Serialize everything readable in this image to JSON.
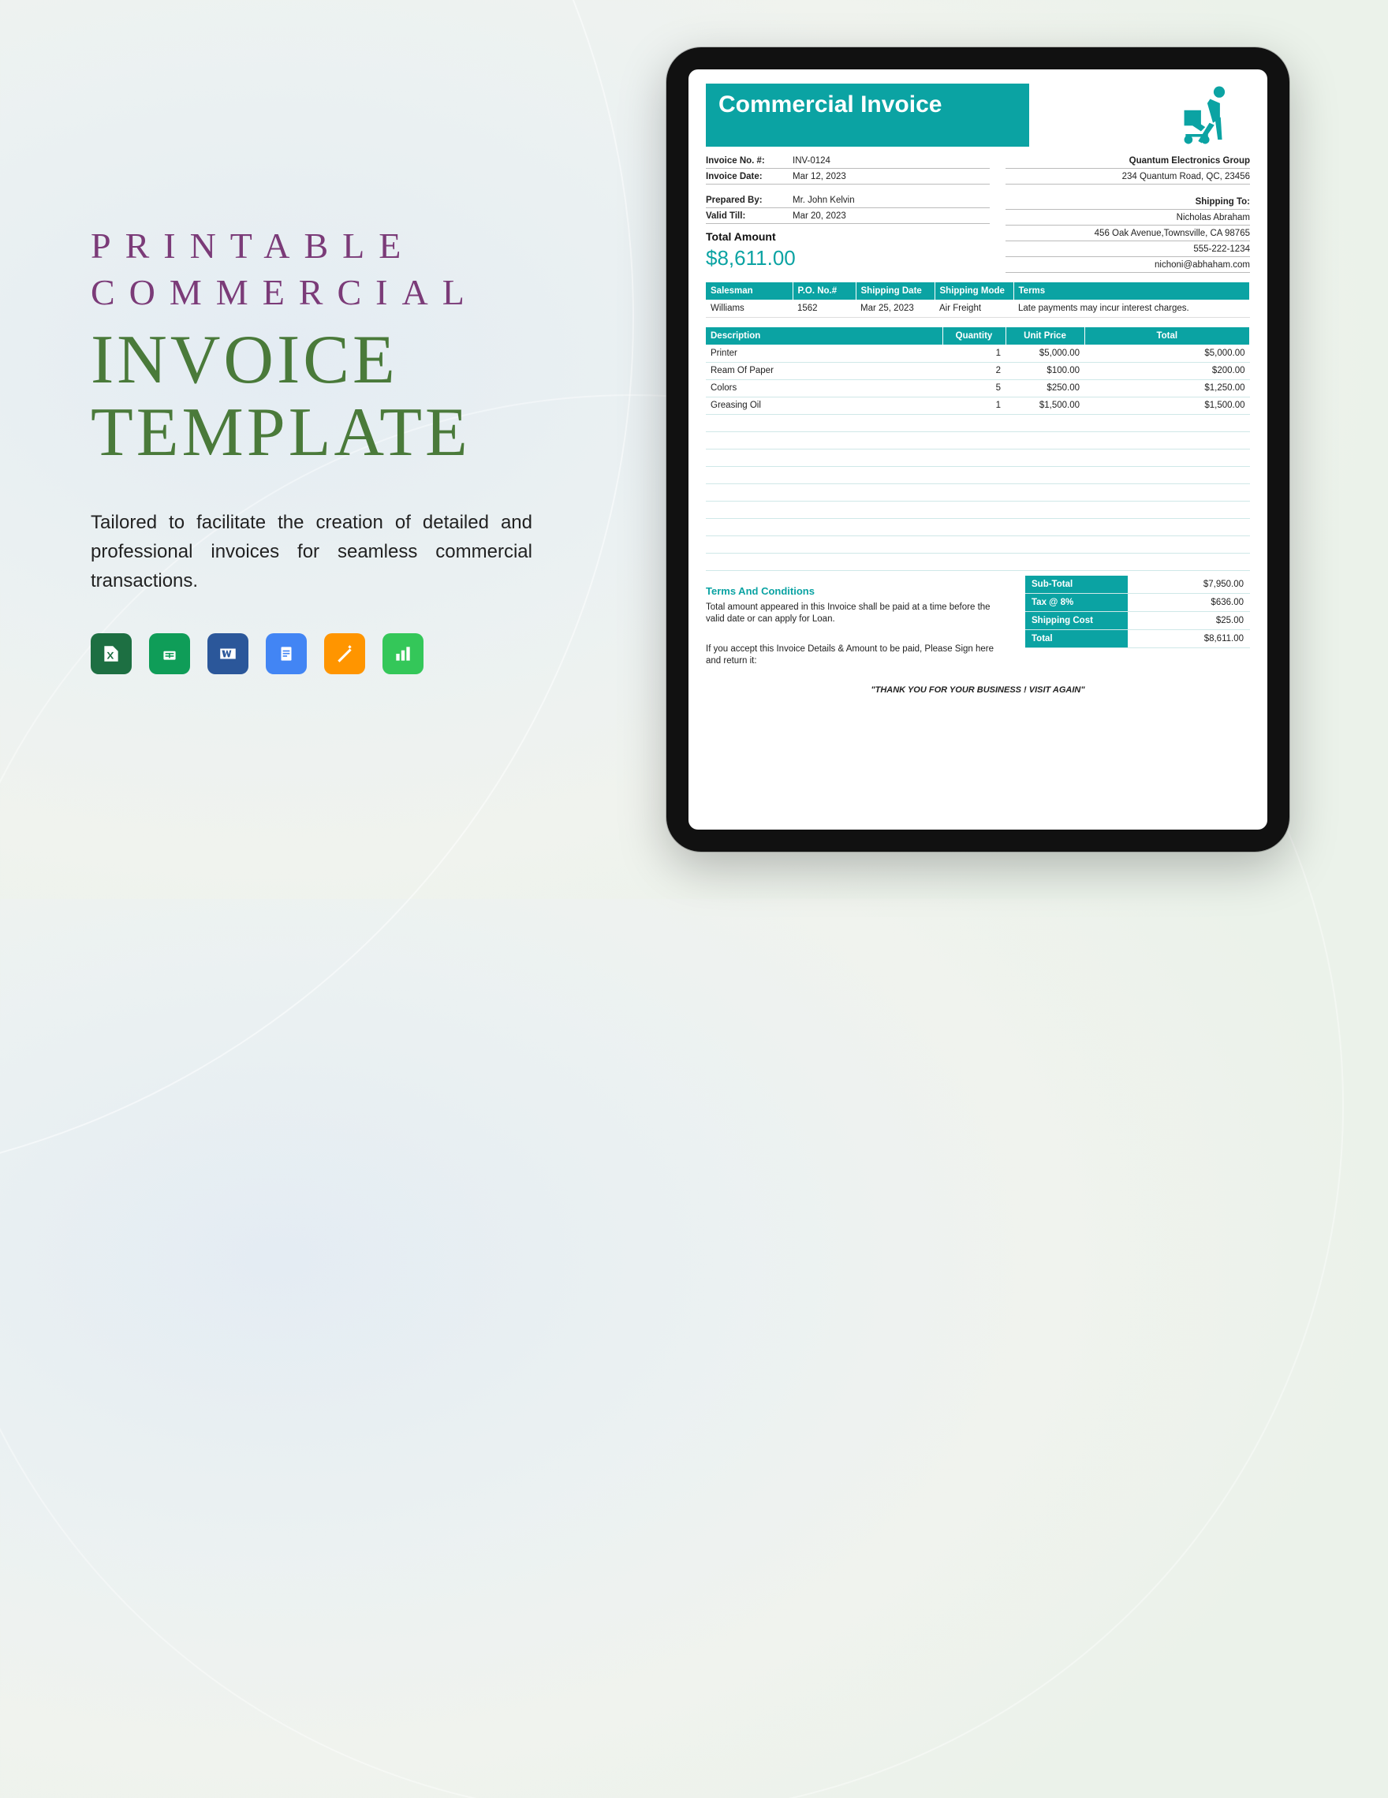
{
  "promo": {
    "line1": "PRINTABLE",
    "line2": "COMMERCIAL",
    "line3": "INVOICE",
    "line4": "TEMPLATE",
    "description": "Tailored to facilitate the creation of detailed and professional invoices for seamless commercial transactions.",
    "apps": [
      "excel",
      "google-sheets",
      "word",
      "google-docs",
      "pages",
      "numbers"
    ]
  },
  "invoice": {
    "title": "Commercial Invoice",
    "labels": {
      "invoice_no": "Invoice No. #:",
      "invoice_date": "Invoice Date:",
      "prepared_by": "Prepared By:",
      "valid_till": "Valid Till:",
      "total_amount": "Total Amount",
      "shipping_to": "Shipping To:"
    },
    "meta": {
      "invoice_no": "INV-0124",
      "invoice_date": "Mar 12, 2023",
      "prepared_by": "Mr. John Kelvin",
      "valid_till": "Mar 20, 2023",
      "total_amount": "$8,611.00",
      "company_name": "Quantum Electronics Group",
      "company_address": "234 Quantum Road, QC, 23456",
      "ship_name": "Nicholas Abraham",
      "ship_address": "456 Oak Avenue,Townsville, CA 98765",
      "ship_phone": "555-222-1234",
      "ship_email": "nichoni@abhaham.com"
    },
    "ship_headers": [
      "Salesman",
      "P.O. No.#",
      "Shipping Date",
      "Shipping Mode",
      "Terms"
    ],
    "ship_row": [
      "Williams",
      "1562",
      "Mar 25, 2023",
      "Air Freight",
      "Late payments may incur interest charges."
    ],
    "item_headers": [
      "Description",
      "Quantity",
      "Unit Price",
      "Total"
    ],
    "items": [
      {
        "desc": "Printer",
        "qty": "1",
        "unit": "$5,000.00",
        "total": "$5,000.00"
      },
      {
        "desc": "Ream Of Paper",
        "qty": "2",
        "unit": "$100.00",
        "total": "$200.00"
      },
      {
        "desc": "Colors",
        "qty": "5",
        "unit": "$250.00",
        "total": "$1,250.00"
      },
      {
        "desc": "Greasing Oil",
        "qty": "1",
        "unit": "$1,500.00",
        "total": "$1,500.00"
      }
    ],
    "terms_title": "Terms And Conditions",
    "terms_text": "Total amount appeared in this Invoice shall be paid at a time before the valid date or can apply for Loan.",
    "accept_text": "If you accept this Invoice Details & Amount to be paid, Please Sign here and return it:",
    "summary": [
      {
        "label": "Sub-Total",
        "value": "$7,950.00"
      },
      {
        "label": "Tax @ 8%",
        "value": "$636.00"
      },
      {
        "label": "Shipping Cost",
        "value": "$25.00"
      },
      {
        "label": "Total",
        "value": "$8,611.00"
      }
    ],
    "thanks": "\"THANK YOU FOR YOUR BUSINESS ! VISIT AGAIN\""
  }
}
